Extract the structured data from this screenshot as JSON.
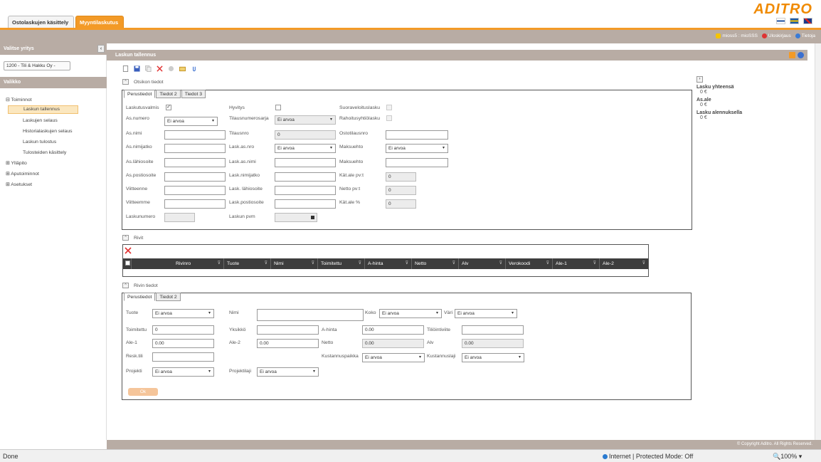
{
  "tabs": {
    "purchase": "Ostolaskujen käsittely",
    "sales": "Myyntilaskutus"
  },
  "logo": "ADITRO",
  "userbar": {
    "user": "mioss5 : mioSSS",
    "logout": "Uloskirjaus",
    "info": "Tietoja"
  },
  "sidebar": {
    "company_header": "Valitse yritys",
    "company_value": "1200 - Tili & Hakku Oy -",
    "menu_header": "Valikko",
    "toiminnot": "Toiminnot",
    "items": [
      "Laskun tallennus",
      "Laskujen selaus",
      "Historialaskujen selaus",
      "Laskun tulostus",
      "Tulosteiden käsittely"
    ],
    "yllapito": "Ylläpito",
    "aputoiminnot": "Aputoiminnot",
    "asetukset": "Asetukset"
  },
  "main": {
    "title": "Laskun tallennus",
    "header_section": "Otsikon tiedot",
    "header_tabs": [
      "Perustiedot",
      "Tiedot 2",
      "Tiedot 3"
    ],
    "fields": {
      "laskutusvalmis": "Laskutusvalmis",
      "hyvitys": "Hyvitys",
      "suoraveloitus": "Suoraveloituslasku",
      "asnumero": "As.numero",
      "asnumero_val": "Ei arvoa",
      "tilausnumerosarja": "Tilausnumerosarja",
      "tilausnumerosarja_val": "Ei arvoa",
      "rahoitus": "Rahoitusyhtiölasku",
      "asnimi": "As.nimi",
      "tilausnro": "Tilausnro",
      "tilausnro_val": "0",
      "ostotilausnro": "Ostotilausnro",
      "asnimijatko": "As.nimijatko",
      "laskasnro": "Lask.as.nro",
      "laskasnro_val": "Ei arvoa",
      "maksuehto": "Maksuehto",
      "maksuehto_val": "Ei arvoa",
      "aslahiosoite": "As.lähiosoite",
      "laskasnimi": "Lask.as.nimi",
      "maksuehto2": "Maksuehto",
      "aspostiosoite": "As.postiosoite",
      "lasknimijatko": "Lask.nimijatko",
      "katalepvt": "Kät.ale pv:t",
      "katalepvt_val": "0",
      "viitteenne": "Viitteenne",
      "lasklahiosoite": "Lask. lähiosoite",
      "nettopvt": "Netto pv:t",
      "nettopvt_val": "0",
      "viitteemme": "Viitteemme",
      "laskpostiosoite": "Lask.postiosoite",
      "katale": "Kät.ale %",
      "katale_val": "0",
      "laskunumero": "Laskunumero",
      "laskunpvm": "Laskun pvm"
    },
    "rows_section": "Rivit",
    "grid_columns": [
      "Rivinro",
      "Tuote",
      "Nimi",
      "Toimitettu",
      "A-hinta",
      "Netto",
      "Alv",
      "Verokoodi",
      "Ale-1",
      "Ale-2"
    ],
    "row_section": "Rivin tiedot",
    "row_tabs": [
      "Perustiedot",
      "Tiedot 2"
    ],
    "row_fields": {
      "tuote": "Tuote",
      "tuote_val": "Ei arvoa",
      "nimi": "Nimi",
      "koko": "Koko",
      "koko_val": "Ei arvoa",
      "vari": "Väri",
      "vari_val": "Ei arvoa",
      "toimitettu": "Toimitettu",
      "toimitettu_val": "0",
      "yksikko": "Yksikkö",
      "ahinta": "A-hinta",
      "ahinta_val": "0.00",
      "tiliointiviite": "Tiliöintiviite",
      "ale1": "Ale-1",
      "ale1_val": "0.00",
      "ale2": "Ale-2",
      "ale2_val": "0.00",
      "netto": "Netto",
      "netto_val": "0.00",
      "alv": "Alv",
      "alv_val": "0.00",
      "resktili": "Resk.tili",
      "kustannuspaikka": "Kustannuspaikka",
      "kustannuspaikka_val": "Ei arvoa",
      "kustannuslaji": "Kustannuslaji",
      "kustannuslaji_val": "Ei arvoa",
      "projekti": "Projekti",
      "projekti_val": "Ei arvoa",
      "projektilaji": "Projektilaji",
      "projektilaji_val": "Ei arvoa"
    },
    "ok": "Ok"
  },
  "summary": {
    "total_label": "Lasku yhteensä",
    "total": "0 €",
    "ale_label": "As.ale",
    "ale": "0 €",
    "disc_label": "Lasku alennuksella",
    "disc": "0 €"
  },
  "footer": "© Copyright Aditro. All Rights Reserved.",
  "status": {
    "left": "Done",
    "zone": "Internet | Protected Mode: Off",
    "zoom": "100%"
  },
  "colors": {
    "accent": "#f39a27",
    "bar": "#b8aca4"
  }
}
